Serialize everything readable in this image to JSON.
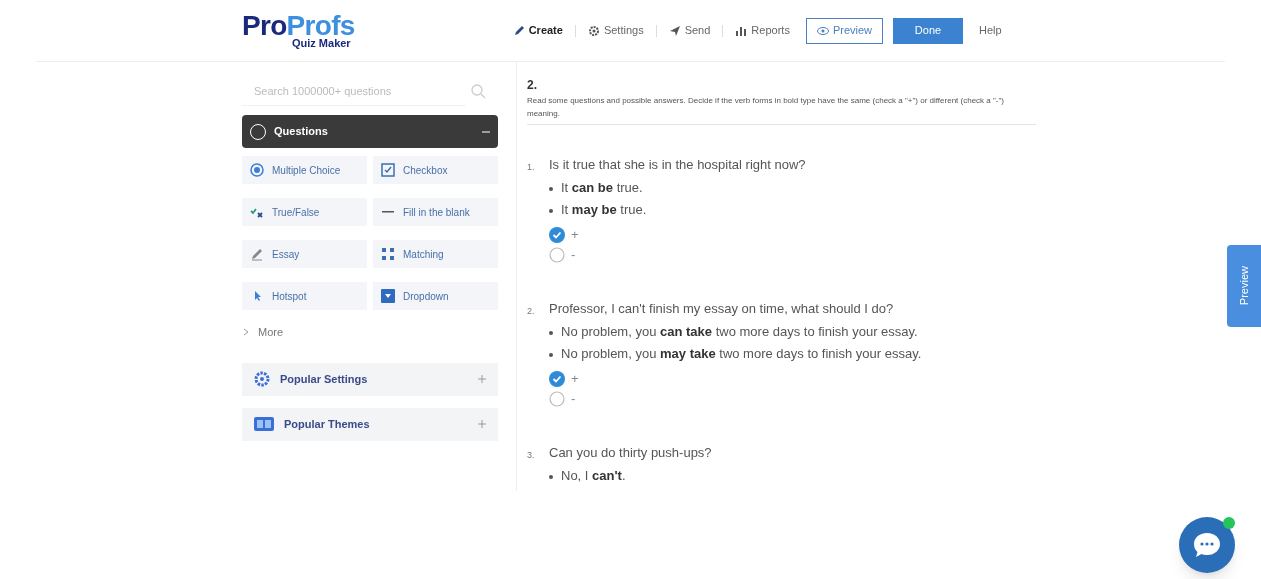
{
  "logo": {
    "brand_dark": "Pro",
    "brand_light": "Profs",
    "subtitle": "Quiz Maker"
  },
  "nav": [
    {
      "label": "Create",
      "selected": true
    },
    {
      "label": "Settings",
      "selected": false
    },
    {
      "label": "Send",
      "selected": false
    },
    {
      "label": "Reports",
      "selected": false
    }
  ],
  "preview_button": "Preview",
  "done_button": "Done",
  "help_link": "Help",
  "sidebar": {
    "search": {
      "placeholder": "Search 1000000+ questions"
    },
    "questions_panel": {
      "title": "Questions",
      "expanded": true
    },
    "question_types": [
      {
        "label": "Multiple Choice"
      },
      {
        "label": "Checkbox"
      },
      {
        "label": "True/False"
      },
      {
        "label": "Fill in the blank"
      },
      {
        "label": "Essay"
      },
      {
        "label": "Matching"
      },
      {
        "label": "Hotspot"
      },
      {
        "label": "Dropdown"
      }
    ],
    "more": "More",
    "panels": [
      {
        "title": "Popular Settings",
        "expanded": false
      },
      {
        "title": "Popular Themes",
        "expanded": false
      }
    ]
  },
  "question": {
    "number": "2.",
    "instructions": "Read some questions and possible answers. Decide if the verb forms in bold type have the same (check a \"+\") or different (check a \"-\") meaning.",
    "items": [
      {
        "number": "1.",
        "prompt": "Is it true that she is in the hospital right now?",
        "bullets": [
          "It **can be** true.",
          "It **may be** true."
        ],
        "options": [
          {
            "label": "+",
            "selected": true
          },
          {
            "label": "-",
            "selected": false
          }
        ]
      },
      {
        "number": "2.",
        "prompt": "Professor, I can't finish my essay on time, what should I do?",
        "bullets": [
          "No problem, you **can take** two more days to finish your essay.",
          "No problem, you **may take** two more days to finish your essay."
        ],
        "options": [
          {
            "label": "+",
            "selected": true
          },
          {
            "label": "-",
            "selected": false
          }
        ]
      },
      {
        "number": "3.",
        "prompt": "Can you do thirty push-ups?",
        "bullets": [
          "No, I **can't**."
        ]
      }
    ]
  },
  "side_preview_tab": "Preview",
  "chat": {
    "online": true
  }
}
